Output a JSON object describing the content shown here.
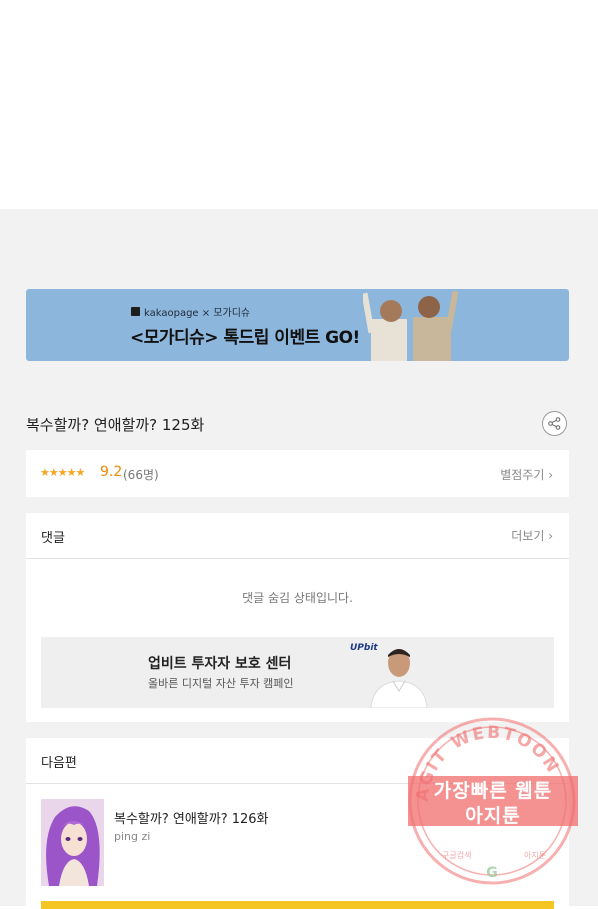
{
  "banner": {
    "brand": "kakaopage × 모가디슈",
    "title": "<모가디슈> 톡드립 이벤트 GO!"
  },
  "episode": {
    "title": "복수할까? 연애할까? 125화"
  },
  "rating": {
    "stars": "★★★★★",
    "score": "9.2",
    "count": "(66명)",
    "rate_link": "별점주기 ›",
    "value": 9.2
  },
  "comments": {
    "title": "댓글",
    "more": "더보기 ›",
    "hidden_message": "댓글 숨김 상태입니다.",
    "ad": {
      "logo": "UPbit",
      "title": "업비트 투자자 보호 센터",
      "subtitle": "올바른 디지털 자산 투자 캠페인"
    }
  },
  "next": {
    "header": "다음편",
    "title": "복수할까? 연애할까? 126화",
    "author": "ping zi"
  },
  "watermark": {
    "arc": "AGIT WEBTOON",
    "line1": "가장빠른 웹툰",
    "line2": "아지툰",
    "bottom_left": "구글검색",
    "bottom_right": "아지툰"
  },
  "colors": {
    "banner_bg": "#8db6dc",
    "accent_orange": "#f08a00",
    "star": "#f5a623",
    "cta_yellow": "#f5c521",
    "watermark": "#f06e6e"
  }
}
